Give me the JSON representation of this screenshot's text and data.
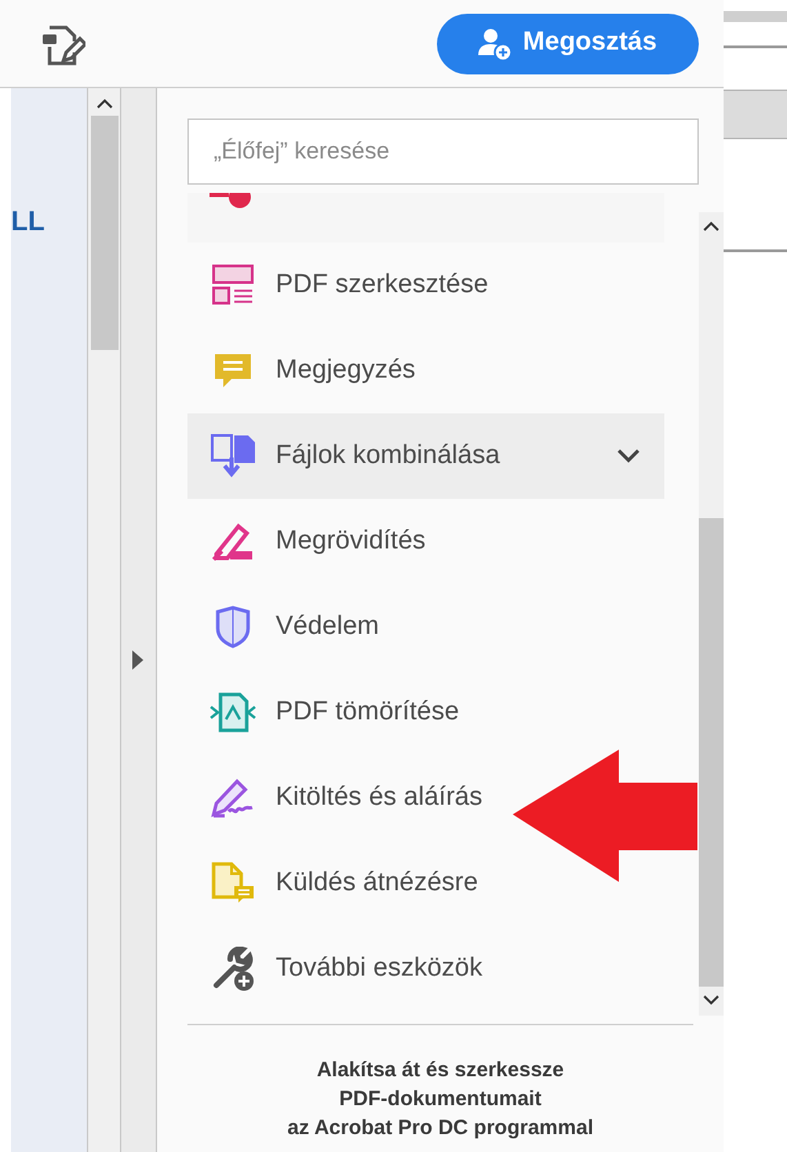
{
  "sidebar": {
    "label": "LL"
  },
  "share_button": {
    "label": "Megosztás"
  },
  "search": {
    "placeholder": "„Élőfej” keresése"
  },
  "tools": [
    {
      "label": "PDF szerkesztése",
      "highlighted": false
    },
    {
      "label": "Megjegyzés",
      "highlighted": false
    },
    {
      "label": "Fájlok kombinálása",
      "highlighted": true,
      "expanded": false
    },
    {
      "label": "Megrövidítés",
      "highlighted": false
    },
    {
      "label": "Védelem",
      "highlighted": false
    },
    {
      "label": "PDF tömörítése",
      "highlighted": false
    },
    {
      "label": "Kitöltés és aláírás",
      "highlighted": false
    },
    {
      "label": "Küldés átnézésre",
      "highlighted": false
    },
    {
      "label": "További eszközök",
      "highlighted": false
    }
  ],
  "promo": {
    "lines": [
      "Alakítsa át és szerkessze",
      "PDF-dokumentumait",
      "az Acrobat Pro DC programmal"
    ]
  }
}
